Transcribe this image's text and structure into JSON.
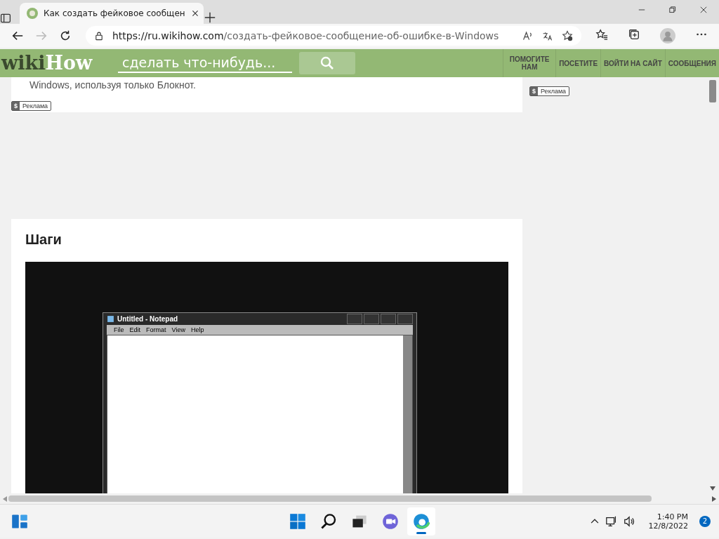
{
  "browser": {
    "tabs": [
      {
        "title": "Как создать фейковое сообщен",
        "selected": true
      }
    ],
    "address_host": "https://ru.wikihow.com",
    "address_path": "/создать-фейковое-сообщение-об-ошибке-в-Windows"
  },
  "site_header": {
    "logo_parts": [
      "wiki",
      "How"
    ],
    "search_placeholder": "сделать что-нибудь...",
    "nav": [
      "ПОМОГИТЕ НАМ",
      "ПОСЕТИТЕ",
      "ВОЙТИ НА САЙТ",
      "СООБЩЕНИЯ"
    ]
  },
  "intro": {
    "text": "Windows, используя только Блокнот.",
    "ad": {
      "symbol": "$",
      "label": "Реклама"
    }
  },
  "sidebar_ad": {
    "symbol": "$",
    "label": "Реклама"
  },
  "steps": {
    "heading": "Шаги",
    "notepad": {
      "title": "Untitled - Notepad",
      "menu": [
        "File",
        "Edit",
        "Format",
        "View",
        "Help"
      ]
    }
  },
  "taskbar": {
    "apps": [
      {
        "kind": "start",
        "active": false
      },
      {
        "kind": "search",
        "active": false
      },
      {
        "kind": "taskview",
        "active": false
      },
      {
        "kind": "chat",
        "active": false
      },
      {
        "kind": "edge",
        "active": true
      }
    ],
    "time": "1:40 PM",
    "date": "12/8/2022",
    "notifications": "2"
  }
}
